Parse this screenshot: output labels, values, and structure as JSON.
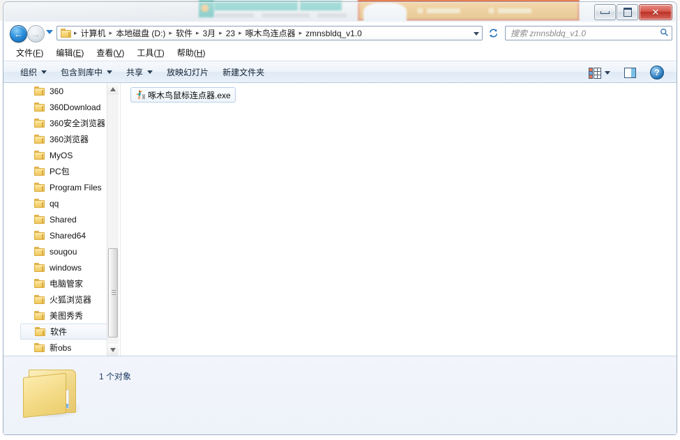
{
  "window": {
    "controls": {
      "minimize_label": "—",
      "maximize_label": "□",
      "close_label": "✕"
    }
  },
  "nav": {
    "back_label": "←",
    "forward_label": "→",
    "history_label": "▼",
    "refresh_label": "↺",
    "address_dropdown_label": "▼"
  },
  "breadcrumb": {
    "folder_icon": "folder-icon",
    "separator": "▸",
    "items": [
      {
        "label": "计算机"
      },
      {
        "label": "本地磁盘 (D:)"
      },
      {
        "label": "软件"
      },
      {
        "label": "3月"
      },
      {
        "label": "23"
      },
      {
        "label": "啄木鸟连点器"
      },
      {
        "label": "zmnsbldq_v1.0"
      }
    ]
  },
  "search": {
    "placeholder": "搜索 zmnsbldq_v1.0",
    "value": "",
    "icon": "search-icon"
  },
  "menubar": {
    "items": [
      {
        "label": "文件",
        "accel": "F"
      },
      {
        "label": "编辑",
        "accel": "E"
      },
      {
        "label": "查看",
        "accel": "V"
      },
      {
        "label": "工具",
        "accel": "T"
      },
      {
        "label": "帮助",
        "accel": "H"
      }
    ]
  },
  "toolbar": {
    "items": [
      {
        "label": "组织",
        "has_caret": true
      },
      {
        "label": "包含到库中",
        "has_caret": true
      },
      {
        "label": "共享",
        "has_caret": true
      },
      {
        "label": "放映幻灯片",
        "has_caret": false
      },
      {
        "label": "新建文件夹",
        "has_caret": false
      }
    ],
    "right": {
      "view_icon": "view-options-icon",
      "view_caret": "▼",
      "preview_icon": "preview-pane-icon",
      "help_icon": "help-icon",
      "help_label": "?"
    }
  },
  "navpane": {
    "tree": [
      {
        "label": "360",
        "selected": false
      },
      {
        "label": "360Download",
        "selected": false
      },
      {
        "label": "360安全浏览器",
        "selected": false
      },
      {
        "label": "360浏览器",
        "selected": false
      },
      {
        "label": "MyOS",
        "selected": false
      },
      {
        "label": "PC包",
        "selected": false
      },
      {
        "label": "Program Files",
        "selected": false
      },
      {
        "label": "qq",
        "selected": false
      },
      {
        "label": "Shared",
        "selected": false
      },
      {
        "label": "Shared64",
        "selected": false
      },
      {
        "label": "sougou",
        "selected": false
      },
      {
        "label": "windows",
        "selected": false
      },
      {
        "label": "电脑管家",
        "selected": false
      },
      {
        "label": "火狐浏览器",
        "selected": false
      },
      {
        "label": "美图秀秀",
        "selected": false
      },
      {
        "label": "软件",
        "selected": true
      },
      {
        "label": "新obs",
        "selected": false
      }
    ],
    "scrollbar": {
      "up_label": "▲",
      "down_label": "▼"
    }
  },
  "files": {
    "items": [
      {
        "name": "啄木鸟鼠标连点器.exe",
        "icon": "woodpecker-exe-icon",
        "selected": true
      }
    ]
  },
  "details": {
    "folder_icon": "large-folder-icon",
    "status": "1 个对象"
  }
}
